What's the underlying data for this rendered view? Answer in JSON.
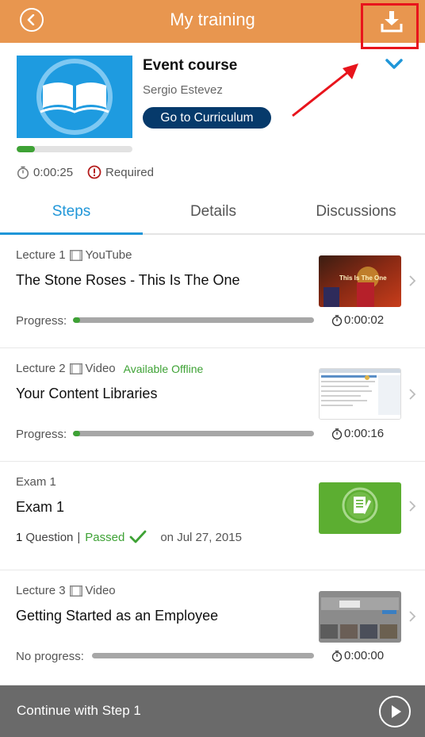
{
  "header": {
    "title": "My training"
  },
  "course": {
    "title": "Event course",
    "author": "Sergio Estevez",
    "curriculum_button": "Go to Curriculum",
    "progress": 0.16,
    "time_spent": "0:00:25",
    "required_label": "Required"
  },
  "tabs": [
    {
      "label": "Steps",
      "active": true
    },
    {
      "label": "Details",
      "active": false
    },
    {
      "label": "Discussions",
      "active": false
    }
  ],
  "steps": [
    {
      "type": "Lecture 1",
      "media": "YouTube",
      "title": "The Stone Roses - This Is The One",
      "progress_label": "Progress:",
      "progress": 0.03,
      "duration": "0:00:02",
      "thumb_caption": "This Is The One"
    },
    {
      "type": "Lecture 2",
      "media": "Video",
      "badge": "Available Offline",
      "title": "Your Content Libraries",
      "progress_label": "Progress:",
      "progress": 0.03,
      "duration": "0:00:16"
    },
    {
      "type": "Exam 1",
      "title": "Exam 1",
      "question_count": "1",
      "question_label": "Question",
      "separator": "|",
      "status": "Passed",
      "date": "on Jul 27, 2015"
    },
    {
      "type": "Lecture 3",
      "media": "Video",
      "title": "Getting Started as an Employee",
      "progress_label": "No progress:",
      "progress": 0,
      "duration": "0:00:00"
    }
  ],
  "bottom_bar": {
    "label": "Continue with Step 1"
  },
  "colors": {
    "header": "#e8964f",
    "accent_blue": "#1f96d8",
    "button_navy": "#063a6b",
    "success_green": "#3ea235",
    "annotation_red": "#e8141c",
    "bottom_bar": "#6a6a6a"
  },
  "icons": {
    "back": "back-circle-icon",
    "download": "download-icon",
    "expand": "chevron-down-icon",
    "timer": "stopwatch-icon",
    "required": "exclamation-circle-icon",
    "media": "film-icon",
    "row_chevron": "chevron-right-icon",
    "passed": "checkmark-icon",
    "play": "play-icon"
  }
}
